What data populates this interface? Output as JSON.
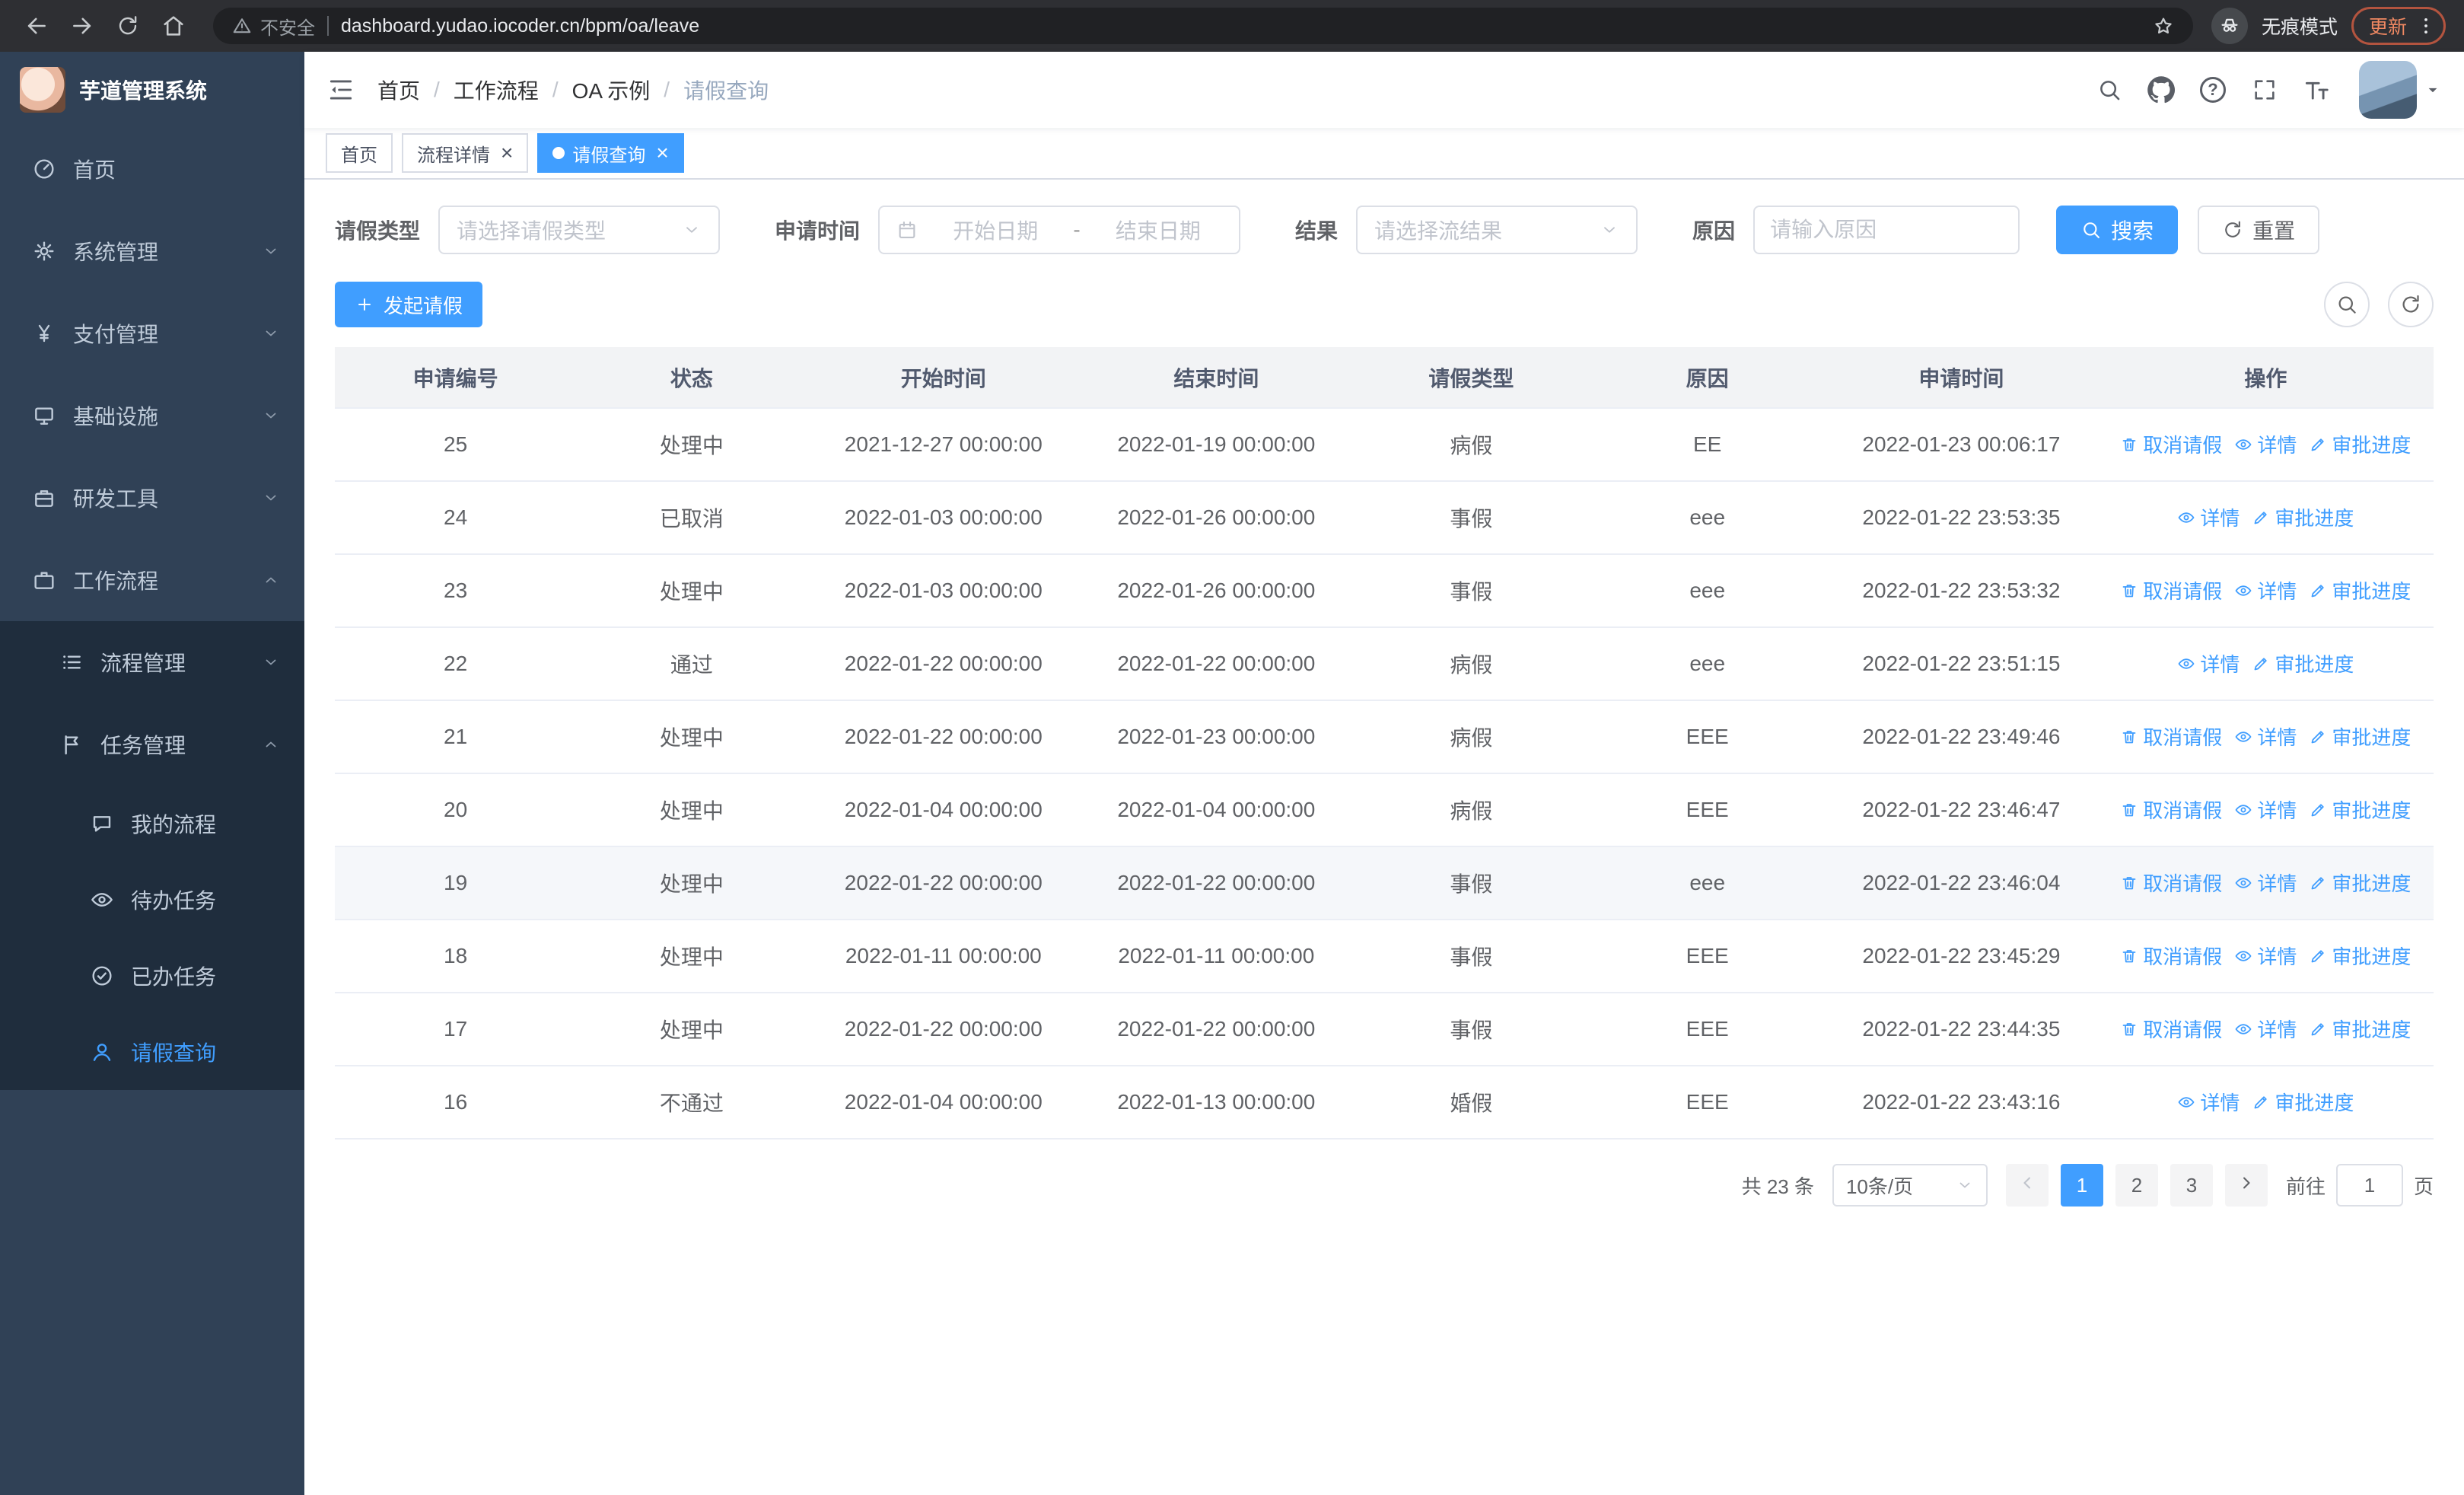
{
  "browser": {
    "security_label": "不安全",
    "url": "dashboard.yudao.iocoder.cn/bpm/oa/leave",
    "incognito_label": "无痕模式",
    "update_label": "更新"
  },
  "header": {
    "breadcrumb": [
      "首页",
      "工作流程",
      "OA 示例",
      "请假查询"
    ]
  },
  "tabs": [
    {
      "key": "home",
      "label": "首页",
      "closable": false,
      "active": false
    },
    {
      "key": "process-detail",
      "label": "流程详情",
      "closable": true,
      "active": false
    },
    {
      "key": "leave-query",
      "label": "请假查询",
      "closable": true,
      "active": true
    }
  ],
  "sidebar": {
    "app_title": "芋道管理系统",
    "menu": [
      {
        "key": "home",
        "label": "首页",
        "icon": "gauge-icon",
        "level": 1,
        "arrow": null
      },
      {
        "key": "system-management",
        "label": "系统管理",
        "icon": "gear-icon",
        "level": 1,
        "arrow": "down"
      },
      {
        "key": "payment-management",
        "label": "支付管理",
        "icon": "yen-icon",
        "level": 1,
        "arrow": "down"
      },
      {
        "key": "infrastructure",
        "label": "基础设施",
        "icon": "monitor-icon",
        "level": 1,
        "arrow": "down"
      },
      {
        "key": "devtools",
        "label": "研发工具",
        "icon": "toolbox-icon",
        "level": 1,
        "arrow": "down"
      },
      {
        "key": "workflow",
        "label": "工作流程",
        "icon": "briefcase-icon",
        "level": 1,
        "arrow": "up"
      },
      {
        "key": "process-management",
        "label": "流程管理",
        "icon": "list-icon",
        "level": 2,
        "arrow": "down"
      },
      {
        "key": "task-management",
        "label": "任务管理",
        "icon": "flag-icon",
        "level": 2,
        "arrow": "up"
      },
      {
        "key": "my-process",
        "label": "我的流程",
        "icon": "chat-icon",
        "level": 3,
        "arrow": null
      },
      {
        "key": "todo-tasks",
        "label": "待办任务",
        "icon": "eye-icon",
        "level": 3,
        "arrow": null
      },
      {
        "key": "done-tasks",
        "label": "已办任务",
        "icon": "check-circle-icon",
        "level": 3,
        "arrow": null
      },
      {
        "key": "leave-query",
        "label": "请假查询",
        "icon": "person-icon",
        "level": 3,
        "arrow": null,
        "active": true
      }
    ]
  },
  "filters": {
    "leave_type": {
      "label": "请假类型",
      "placeholder": "请选择请假类型"
    },
    "apply_time": {
      "label": "申请时间",
      "start_placeholder": "开始日期",
      "separator": "-",
      "end_placeholder": "结束日期"
    },
    "result": {
      "label": "结果",
      "placeholder": "请选择流结果"
    },
    "reason": {
      "label": "原因",
      "placeholder": "请输入原因"
    },
    "search_label": "搜索",
    "reset_label": "重置"
  },
  "toolbar": {
    "create_label": "发起请假"
  },
  "table": {
    "columns": [
      "申请编号",
      "状态",
      "开始时间",
      "结束时间",
      "请假类型",
      "原因",
      "申请时间",
      "操作"
    ],
    "action_labels": {
      "cancel": "取消请假",
      "detail": "详情",
      "progress": "审批进度"
    },
    "rows": [
      {
        "id": "25",
        "status": "处理中",
        "start": "2021-12-27 00:00:00",
        "end": "2022-01-19 00:00:00",
        "type": "病假",
        "reason": "EE",
        "applied": "2022-01-23 00:06:17",
        "actions": [
          "cancel",
          "detail",
          "progress"
        ]
      },
      {
        "id": "24",
        "status": "已取消",
        "start": "2022-01-03 00:00:00",
        "end": "2022-01-26 00:00:00",
        "type": "事假",
        "reason": "eee",
        "applied": "2022-01-22 23:53:35",
        "actions": [
          "detail",
          "progress"
        ]
      },
      {
        "id": "23",
        "status": "处理中",
        "start": "2022-01-03 00:00:00",
        "end": "2022-01-26 00:00:00",
        "type": "事假",
        "reason": "eee",
        "applied": "2022-01-22 23:53:32",
        "actions": [
          "cancel",
          "detail",
          "progress"
        ]
      },
      {
        "id": "22",
        "status": "通过",
        "start": "2022-01-22 00:00:00",
        "end": "2022-01-22 00:00:00",
        "type": "病假",
        "reason": "eee",
        "applied": "2022-01-22 23:51:15",
        "actions": [
          "detail",
          "progress"
        ]
      },
      {
        "id": "21",
        "status": "处理中",
        "start": "2022-01-22 00:00:00",
        "end": "2022-01-23 00:00:00",
        "type": "病假",
        "reason": "EEE",
        "applied": "2022-01-22 23:49:46",
        "actions": [
          "cancel",
          "detail",
          "progress"
        ]
      },
      {
        "id": "20",
        "status": "处理中",
        "start": "2022-01-04 00:00:00",
        "end": "2022-01-04 00:00:00",
        "type": "病假",
        "reason": "EEE",
        "applied": "2022-01-22 23:46:47",
        "actions": [
          "cancel",
          "detail",
          "progress"
        ]
      },
      {
        "id": "19",
        "status": "处理中",
        "start": "2022-01-22 00:00:00",
        "end": "2022-01-22 00:00:00",
        "type": "事假",
        "reason": "eee",
        "applied": "2022-01-22 23:46:04",
        "actions": [
          "cancel",
          "detail",
          "progress"
        ],
        "hover": true
      },
      {
        "id": "18",
        "status": "处理中",
        "start": "2022-01-11 00:00:00",
        "end": "2022-01-11 00:00:00",
        "type": "事假",
        "reason": "EEE",
        "applied": "2022-01-22 23:45:29",
        "actions": [
          "cancel",
          "detail",
          "progress"
        ]
      },
      {
        "id": "17",
        "status": "处理中",
        "start": "2022-01-22 00:00:00",
        "end": "2022-01-22 00:00:00",
        "type": "事假",
        "reason": "EEE",
        "applied": "2022-01-22 23:44:35",
        "actions": [
          "cancel",
          "detail",
          "progress"
        ]
      },
      {
        "id": "16",
        "status": "不通过",
        "start": "2022-01-04 00:00:00",
        "end": "2022-01-13 00:00:00",
        "type": "婚假",
        "reason": "EEE",
        "applied": "2022-01-22 23:43:16",
        "actions": [
          "detail",
          "progress"
        ]
      }
    ]
  },
  "pagination": {
    "total_label": "共 23 条",
    "page_size": "10条/页",
    "pages": [
      "1",
      "2",
      "3"
    ],
    "active_page": "1",
    "goto_label": "前往",
    "goto_value": "1",
    "page_label": "页"
  },
  "colors": {
    "accent": "#409eff",
    "sidebar_bg": "#304156",
    "submenu_bg": "#1f2d3d"
  }
}
